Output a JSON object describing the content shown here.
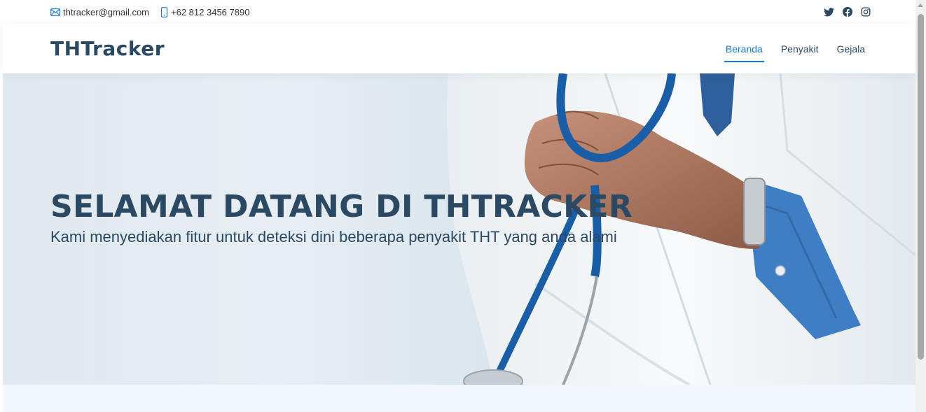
{
  "topbar": {
    "email": "thtracker@gmail.com",
    "phone": "+62 812 3456 7890",
    "social_icons": [
      "twitter-icon",
      "facebook-icon",
      "instagram-icon"
    ]
  },
  "header": {
    "logo": "THTracker",
    "nav": [
      {
        "label": "Beranda",
        "active": true
      },
      {
        "label": "Penyakit",
        "active": false
      },
      {
        "label": "Gejala",
        "active": false
      }
    ]
  },
  "hero": {
    "title": "SELAMAT DATANG DI THTRACKER",
    "subtitle": "Kami menyediakan fitur untuk deteksi dini beberapa penyakit THT yang anda alami"
  },
  "colors": {
    "primary": "#2c4964",
    "accent": "#1977cc",
    "band": "#f1f7fd"
  }
}
